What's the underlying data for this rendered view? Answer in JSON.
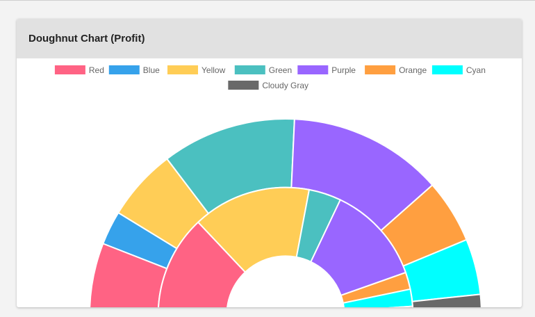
{
  "card": {
    "title": "Doughnut Chart (Profit)"
  },
  "chart_data": {
    "type": "doughnut",
    "half": true,
    "legend_position": "top",
    "labels": [
      "Red",
      "Blue",
      "Yellow",
      "Green",
      "Purple",
      "Orange",
      "Cyan",
      "Cloudy Gray"
    ],
    "colors": [
      "#ff6384",
      "#36a2eb",
      "#ffcd56",
      "#4bc0c0",
      "#9966ff",
      "#ff9f40",
      "#00ffff",
      "#696969"
    ],
    "datasets": [
      {
        "values": [
          5.3,
          2.5,
          5.3,
          9.9,
          11.4,
          4.7,
          4.1,
          1.5
        ]
      },
      {
        "values": [
          12.0,
          0,
          13.9,
          3.8,
          11.6,
          2.0,
          2.0,
          1.0
        ]
      }
    ]
  }
}
